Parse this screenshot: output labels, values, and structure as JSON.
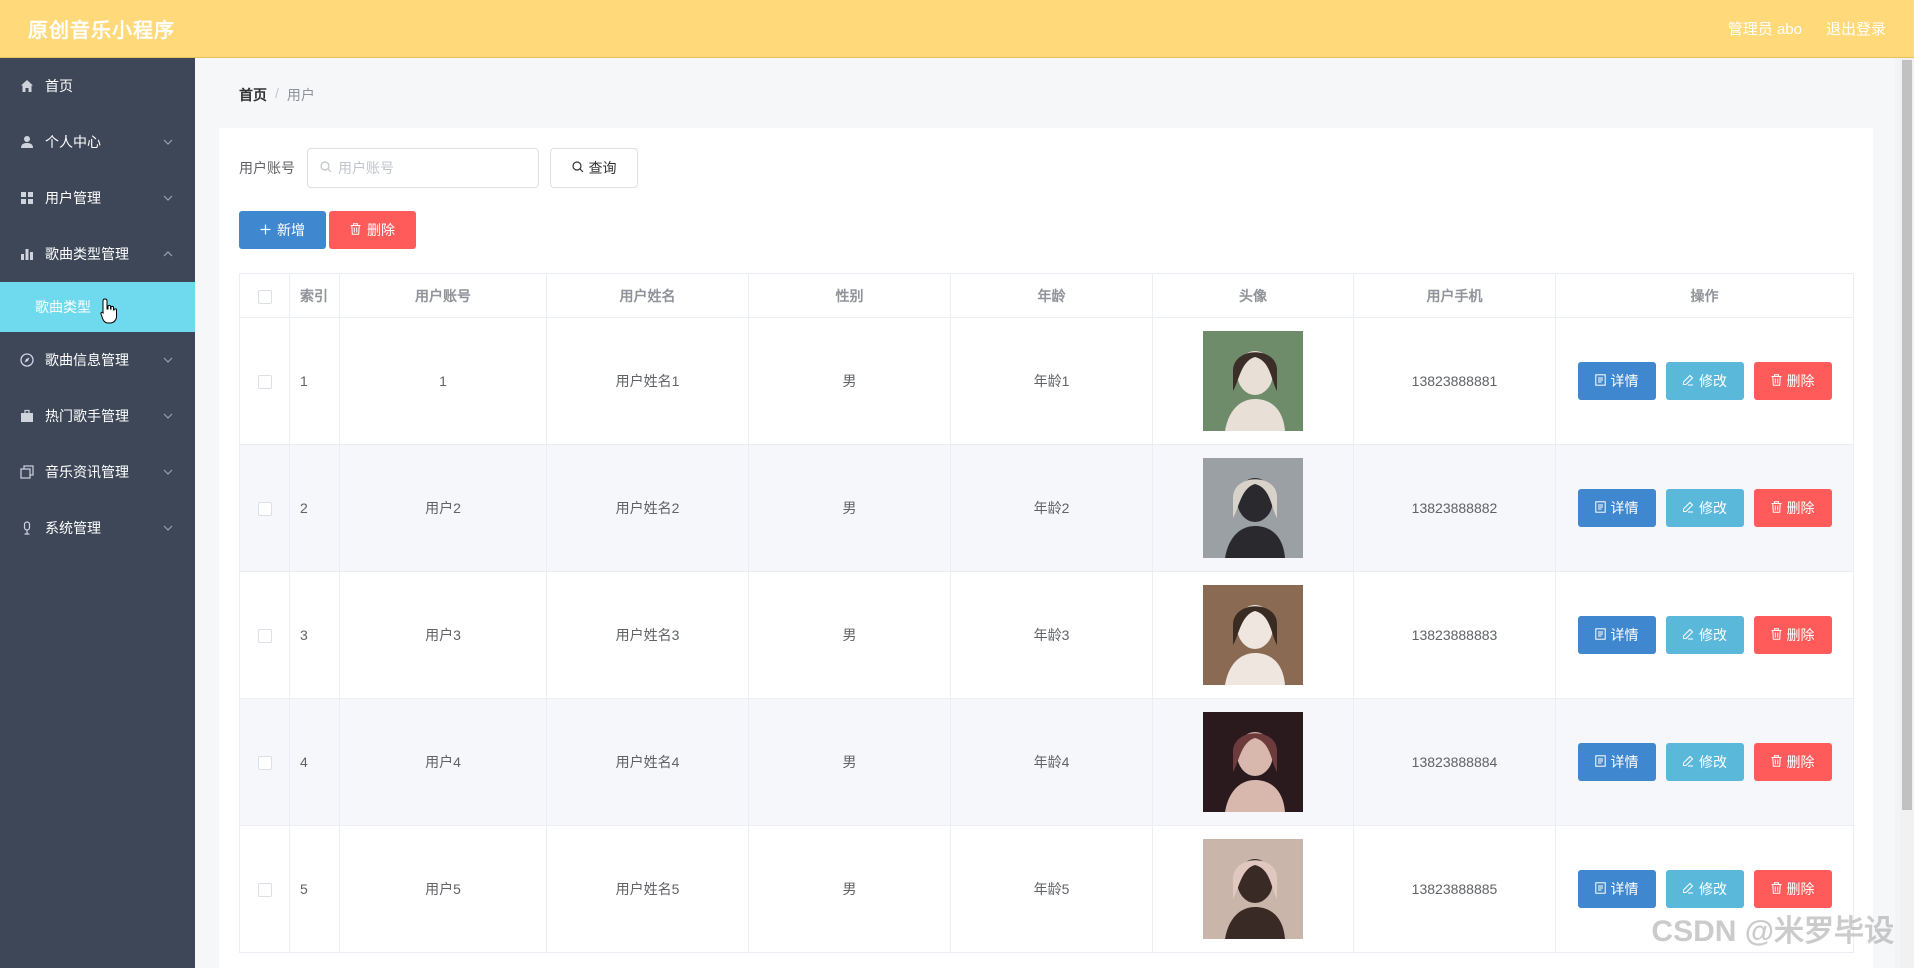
{
  "header": {
    "title": "原创音乐小程序",
    "user": "管理员 abo",
    "logout": "退出登录"
  },
  "sidebar": {
    "items": [
      {
        "label": "首页",
        "icon": "home-icon",
        "expandable": false
      },
      {
        "label": "个人中心",
        "icon": "user-icon",
        "expandable": true
      },
      {
        "label": "用户管理",
        "icon": "grid-icon",
        "expandable": true
      },
      {
        "label": "歌曲类型管理",
        "icon": "bar-chart-icon",
        "expandable": true,
        "expanded": true
      },
      {
        "label": "歌曲信息管理",
        "icon": "compass-icon",
        "expandable": true
      },
      {
        "label": "热门歌手管理",
        "icon": "briefcase-icon",
        "expandable": true
      },
      {
        "label": "音乐资讯管理",
        "icon": "copy-icon",
        "expandable": true
      },
      {
        "label": "系统管理",
        "icon": "mic-icon",
        "expandable": true
      }
    ],
    "submenu": {
      "label": "歌曲类型"
    }
  },
  "breadcrumb": {
    "home": "首页",
    "separator": "/",
    "current": "用户"
  },
  "search": {
    "label": "用户账号",
    "placeholder": "用户账号",
    "button": "查询"
  },
  "actions": {
    "add": "新增",
    "delete": "删除"
  },
  "table": {
    "headers": [
      "索引",
      "用户账号",
      "用户姓名",
      "性别",
      "年龄",
      "头像",
      "用户手机",
      "操作"
    ],
    "rows": [
      {
        "index": "1",
        "account": "1",
        "name": "用户姓名1",
        "gender": "男",
        "age": "年龄1",
        "phone": "13823888881"
      },
      {
        "index": "2",
        "account": "用户2",
        "name": "用户姓名2",
        "gender": "男",
        "age": "年龄2",
        "phone": "13823888882"
      },
      {
        "index": "3",
        "account": "用户3",
        "name": "用户姓名3",
        "gender": "男",
        "age": "年龄3",
        "phone": "13823888883"
      },
      {
        "index": "4",
        "account": "用户4",
        "name": "用户姓名4",
        "gender": "男",
        "age": "年龄4",
        "phone": "13823888884"
      },
      {
        "index": "5",
        "account": "用户5",
        "name": "用户姓名5",
        "gender": "男",
        "age": "年龄5",
        "phone": "13823888885"
      }
    ],
    "row_actions": {
      "detail": "详情",
      "edit": "修改",
      "delete": "删除"
    }
  },
  "watermark": "CSDN @米罗毕设",
  "colors": {
    "header": "#ffd97a",
    "sidebar": "#3e4758",
    "submenu_active": "#6fd9ed",
    "primary": "#3f88cf",
    "info": "#5ab8db",
    "danger": "#ff5b5b"
  }
}
